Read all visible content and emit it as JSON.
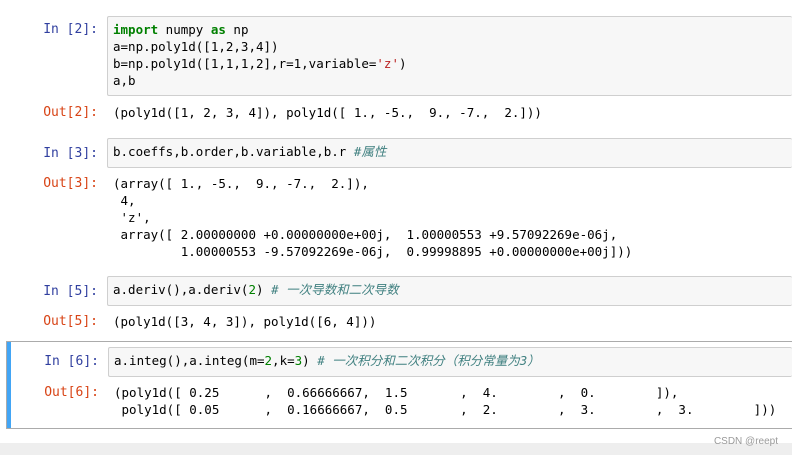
{
  "cells": {
    "c2": {
      "in_prompt": "In  [2]:",
      "out_prompt": "Out[2]:",
      "code": {
        "l1_kw1": "import",
        "l1_a": " numpy ",
        "l1_kw2": "as",
        "l1_b": " np",
        "l2": "a=np.poly1d([1,2,3,4])",
        "l3_a": "b=np.poly1d([1,1,1,2],r=1,variable=",
        "l3_str": "'z'",
        "l3_b": ")",
        "l4": "a,b"
      },
      "output": [
        "(poly1d([1, 2, 3, 4]), poly1d([ 1., -5.,  9., -7.,  2.]))"
      ]
    },
    "c3": {
      "in_prompt": "In  [3]:",
      "out_prompt": "Out[3]:",
      "code": {
        "text": "b.coeffs,b.order,b.variable,b.r ",
        "comment": "#属性"
      },
      "output": [
        "(array([ 1., -5.,  9., -7.,  2.]),",
        " 4,",
        " 'z',",
        " array([ 2.00000000 +0.00000000e+00j,  1.00000553 +9.57092269e-06j,",
        "         1.00000553 -9.57092269e-06j,  0.99998895 +0.00000000e+00j]))"
      ]
    },
    "c5": {
      "in_prompt": "In  [5]:",
      "out_prompt": "Out[5]:",
      "code": {
        "a": "a.deriv(),a.deriv(",
        "num": "2",
        "b": ") ",
        "comment": "# 一次导数和二次导数"
      },
      "output": [
        "(poly1d([3, 4, 3]), poly1d([6, 4]))"
      ]
    },
    "c6": {
      "in_prompt": "In  [6]:",
      "out_prompt": "Out[6]:",
      "code": {
        "a": "a.integ(),a.integ(m=",
        "num1": "2",
        "b": ",k=",
        "num2": "3",
        "c": ") ",
        "comment": "# 一次积分和二次积分（积分常量为3）"
      },
      "output": [
        "(poly1d([ 0.25      ,  0.66666667,  1.5       ,  4.        ,  0.        ]),",
        " poly1d([ 0.05      ,  0.16666667,  0.5       ,  2.        ,  3.        ,  3.        ]))"
      ]
    }
  },
  "watermark": "CSDN @reept",
  "colors": {
    "in_prompt": "#303f9f",
    "out_prompt": "#d84315",
    "selected_bar": "#42a5f5",
    "keyword": "#008000",
    "comment": "#408080",
    "string": "#ba2121"
  }
}
